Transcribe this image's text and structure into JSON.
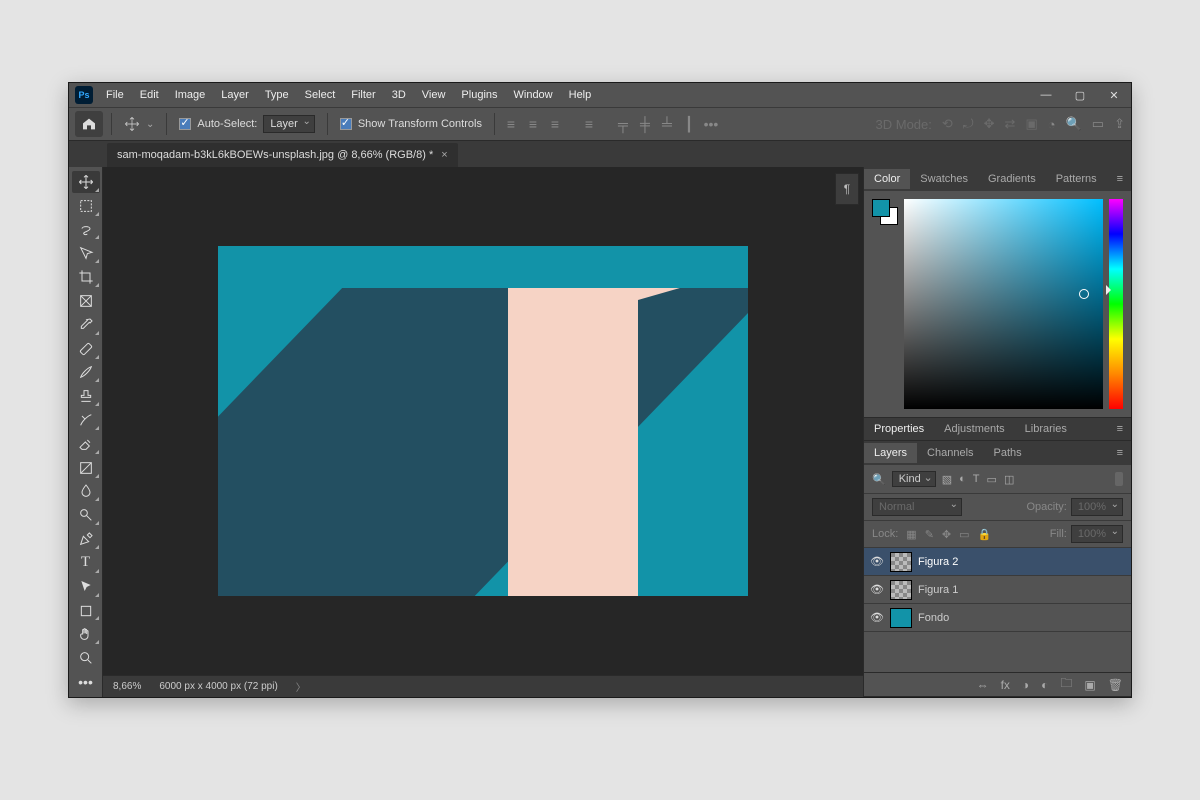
{
  "app_icon_text": "Ps",
  "menu": [
    "File",
    "Edit",
    "Image",
    "Layer",
    "Type",
    "Select",
    "Filter",
    "3D",
    "View",
    "Plugins",
    "Window",
    "Help"
  ],
  "options": {
    "auto_select_label": "Auto-Select:",
    "auto_select_target": "Layer",
    "show_transform_label": "Show Transform Controls",
    "three_d_mode_label": "3D Mode:"
  },
  "document": {
    "tab_title": "sam-moqadam-b3kL6kBOEWs-unsplash.jpg @ 8,66% (RGB/8) *"
  },
  "status": {
    "zoom": "8,66%",
    "dims": "6000 px x 4000 px (72 ppi)"
  },
  "panels": {
    "color_tabs": [
      "Color",
      "Swatches",
      "Gradients",
      "Patterns"
    ],
    "props_tabs": [
      "Properties",
      "Adjustments",
      "Libraries"
    ],
    "layer_tabs": [
      "Layers",
      "Channels",
      "Paths"
    ]
  },
  "layers": {
    "kind_label": "Kind",
    "blend_mode": "Normal",
    "opacity_label": "Opacity:",
    "opacity_value": "100%",
    "lock_label": "Lock:",
    "fill_label": "Fill:",
    "fill_value": "100%",
    "items": [
      {
        "name": "Figura 2"
      },
      {
        "name": "Figura 1"
      },
      {
        "name": "Fondo"
      }
    ]
  },
  "colors": {
    "foreground": "#1293a8",
    "background": "#ffffff"
  }
}
